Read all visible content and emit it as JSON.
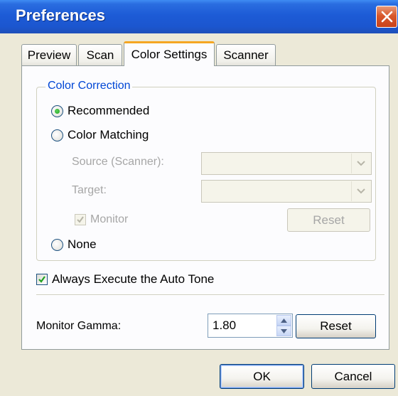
{
  "window": {
    "title": "Preferences"
  },
  "tabs": [
    {
      "label": "Preview",
      "active": false
    },
    {
      "label": "Scan",
      "active": false
    },
    {
      "label": "Color Settings",
      "active": true
    },
    {
      "label": "Scanner",
      "active": false
    }
  ],
  "color_correction": {
    "group_label": "Color Correction",
    "options": [
      {
        "label": "Recommended",
        "selected": true
      },
      {
        "label": "Color Matching",
        "selected": false
      },
      {
        "label": "None",
        "selected": false
      }
    ],
    "source_label": "Source (Scanner):",
    "source_value": "",
    "target_label": "Target:",
    "target_value": "",
    "monitor_label": "Monitor",
    "monitor_checked": true,
    "reset_label": "Reset"
  },
  "auto_tone": {
    "label": "Always Execute the Auto Tone",
    "checked": true
  },
  "gamma": {
    "label": "Monitor Gamma:",
    "value": "1.80",
    "reset_label": "Reset"
  },
  "footer": {
    "ok_label": "OK",
    "cancel_label": "Cancel"
  },
  "icons": {
    "close": "close-icon",
    "dropdown": "chevron-down-icon",
    "check": "check-icon",
    "spin_up": "triangle-up-icon",
    "spin_down": "triangle-down-icon"
  },
  "colors": {
    "titlebar": "#1d5bd6",
    "group_label": "#0046d5",
    "active_tab_accent": "#f5a623",
    "disabled_text": "#a6a6a6",
    "window_bg": "#ece9d8"
  }
}
